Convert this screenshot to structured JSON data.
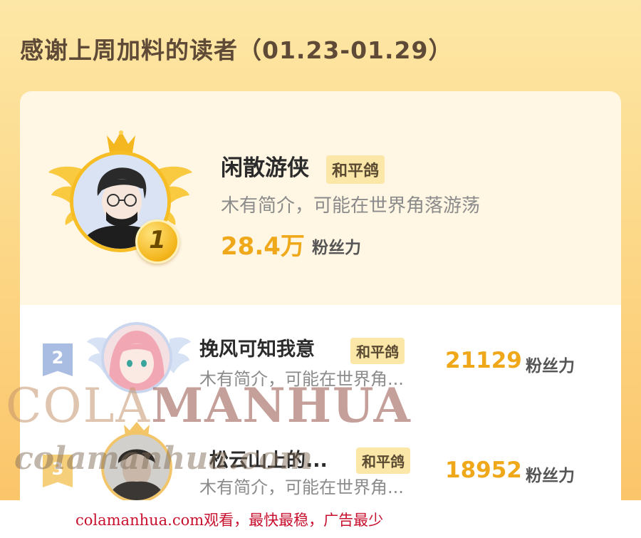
{
  "header": {
    "title": "感谢上周加料的读者（01.23-01.29）"
  },
  "leaderboard": [
    {
      "rank": "1",
      "name": "闲散游侠",
      "tag": "和平鸽",
      "intro": "木有简介，可能在世界角落游荡",
      "score": "28.4万",
      "score_unit": "粉丝力"
    },
    {
      "rank": "2",
      "name": "挽风可知我意",
      "tag": "和平鸽",
      "intro": "木有简介，可能在世界角...",
      "score": "21129",
      "score_unit": "粉丝力"
    },
    {
      "rank": "3",
      "name": "松云山上的...",
      "tag": "和平鸽",
      "intro": "木有简介，可能在世界角...",
      "score": "18952",
      "score_unit": "粉丝力"
    }
  ],
  "watermark": {
    "line1_a": "COLA",
    "line1_b": "MANHUA",
    "line2": "colamanhua.com"
  },
  "footer": {
    "text": "colamanhua.com观看，最快最稳，广告最少"
  },
  "colors": {
    "accent": "#f0a81b",
    "background": "#fcd98a",
    "tag": "#fbe7a7",
    "footer_text": "#c8102e"
  },
  "icons": [
    "crown-icon",
    "wings-icon",
    "rank-badge-icon",
    "avatar-image"
  ]
}
